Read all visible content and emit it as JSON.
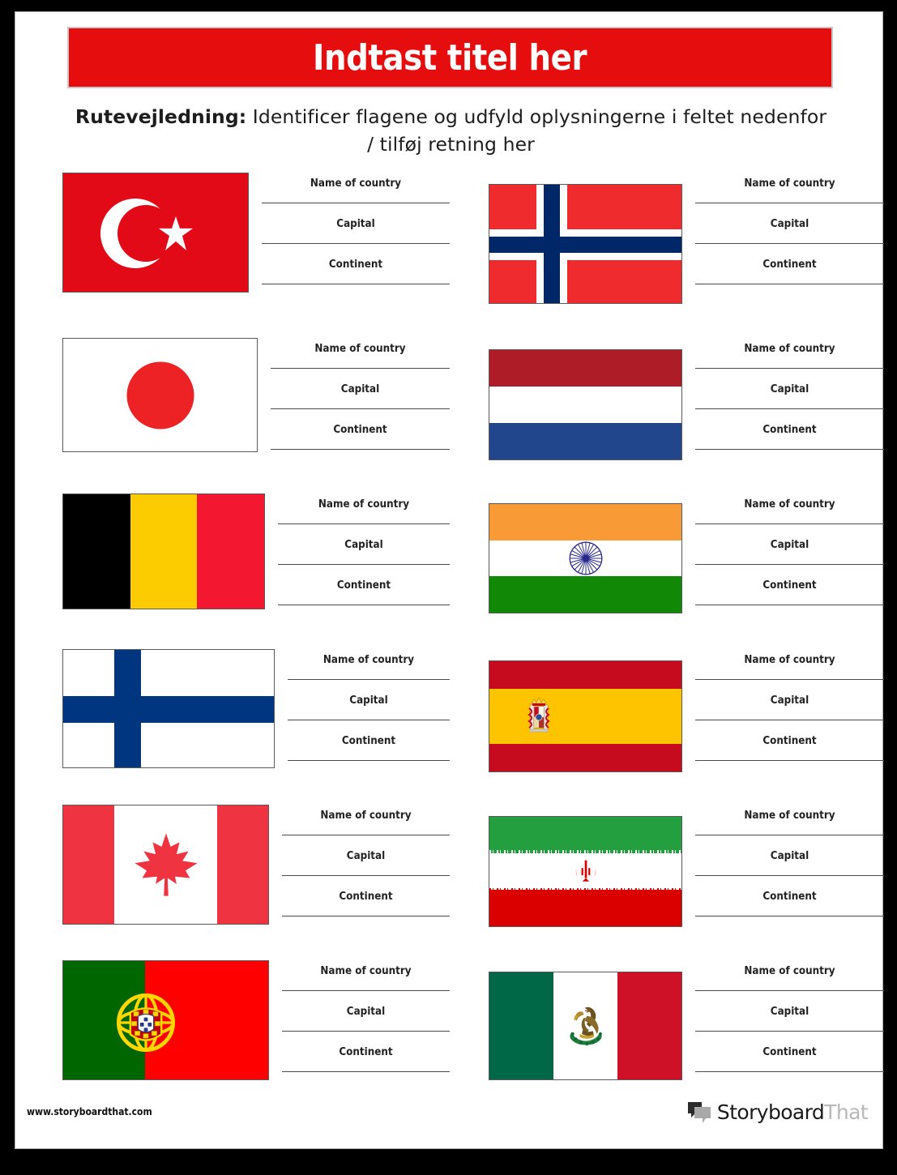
{
  "header": {
    "title": "Indtast titel her",
    "instructions_bold": "Rutevejledning:",
    "instructions_rest": " Identificer flagene og udfyld oplysningerne i feltet nedenfor / tilføj retning her"
  },
  "field_labels": {
    "name_of_country": "Name of country",
    "capital": "Capital",
    "continent": "Continent"
  },
  "colors": {
    "banner_red": "#e50d0d",
    "page_background": "#ffffff",
    "outer_frame": "#000000",
    "rule_line": "#4a4a4a",
    "label_text": "#222222"
  },
  "flags": [
    {
      "id": "turkey",
      "name": "turkey-flag",
      "row": 1,
      "column": "left",
      "colors": {
        "field": "#e30a17",
        "star": "#ffffff"
      }
    },
    {
      "id": "norway",
      "name": "norway-flag",
      "row": 1,
      "column": "right",
      "colors": {
        "field": "#ef2b2d",
        "cross": "#002868",
        "border": "#ffffff"
      }
    },
    {
      "id": "japan",
      "name": "japan-flag",
      "row": 2,
      "column": "left",
      "colors": {
        "field": "#ffffff",
        "disc": "#ed2224"
      }
    },
    {
      "id": "netherlands",
      "name": "netherlands-flag",
      "row": 2,
      "column": "right",
      "colors": {
        "red": "#ae1c28",
        "white": "#ffffff",
        "blue": "#21468b"
      }
    },
    {
      "id": "belgium",
      "name": "belgium-flag",
      "row": 3,
      "column": "left",
      "colors": {
        "black": "#000000",
        "yellow": "#fdcc00",
        "red": "#f31830"
      }
    },
    {
      "id": "india",
      "name": "india-flag",
      "row": 3,
      "column": "right",
      "colors": {
        "saffron": "#f89b36",
        "white": "#ffffff",
        "green": "#128807",
        "chakra": "#2a2a8c"
      }
    },
    {
      "id": "finland",
      "name": "finland-flag",
      "row": 4,
      "column": "left",
      "colors": {
        "field": "#ffffff",
        "cross": "#003580"
      }
    },
    {
      "id": "spain",
      "name": "spain-flag",
      "row": 4,
      "column": "right",
      "colors": {
        "red": "#c60b1e",
        "yellow": "#ffc400"
      }
    },
    {
      "id": "canada",
      "name": "canada-flag",
      "row": 5,
      "column": "left",
      "colors": {
        "red": "#ef3340",
        "white": "#ffffff"
      }
    },
    {
      "id": "iran",
      "name": "iran-flag",
      "row": 5,
      "column": "right",
      "colors": {
        "green": "#239f40",
        "white": "#ffffff",
        "red": "#da0000",
        "emblem": "#da0000"
      }
    },
    {
      "id": "portugal",
      "name": "portugal-flag",
      "row": 6,
      "column": "left",
      "colors": {
        "green": "#006600",
        "red": "#ff0000",
        "gold": "#ffd700"
      }
    },
    {
      "id": "mexico",
      "name": "mexico-flag",
      "row": 6,
      "column": "right",
      "colors": {
        "green": "#006847",
        "white": "#ffffff",
        "red": "#ce1126",
        "emblem": "#8c6b29"
      }
    }
  ],
  "footer": {
    "url": "www.storyboardthat.com",
    "logo_primary": "Storyboard",
    "logo_secondary": "That"
  }
}
